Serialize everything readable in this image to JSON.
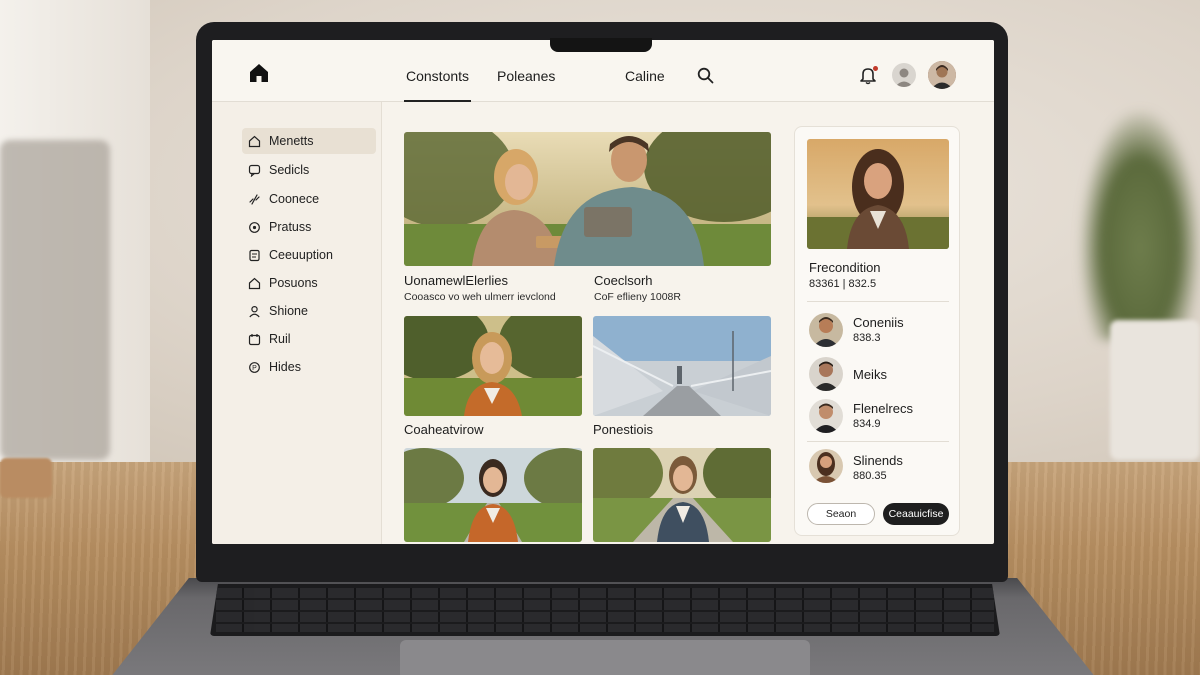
{
  "header": {
    "tabs": [
      {
        "label": "Constonts",
        "active": true
      },
      {
        "label": "Poleanes",
        "active": false
      },
      {
        "label": "Caline",
        "active": false
      }
    ],
    "icons": [
      "home-icon",
      "search-icon",
      "bell-icon",
      "avatar",
      "avatar"
    ]
  },
  "sidebar": {
    "items": [
      {
        "label": "Menetts",
        "icon": "home-icon",
        "active": true
      },
      {
        "label": "Sedicls",
        "icon": "chat-icon",
        "active": false
      },
      {
        "label": "Coonece",
        "icon": "link-icon",
        "active": false
      },
      {
        "label": "Pratuss",
        "icon": "settings-icon",
        "active": false
      },
      {
        "label": "Ceeuuption",
        "icon": "document-icon",
        "active": false
      },
      {
        "label": "Posuons",
        "icon": "home-icon",
        "active": false
      },
      {
        "label": "Shione",
        "icon": "user-icon",
        "active": false
      },
      {
        "label": "Ruil",
        "icon": "calendar-icon",
        "active": false
      },
      {
        "label": "Hides",
        "icon": "help-icon",
        "active": false
      }
    ]
  },
  "main": {
    "featured": {
      "title_left": "UonamewlElerlies",
      "subtitle_left": "Cooasco vo weh ulmerr ievclond",
      "title_right": "Coeclsorh",
      "subtitle_right": "CoF eflieny 1008R"
    },
    "cards": [
      {
        "caption": "Coaheatvirow"
      },
      {
        "caption": "Ponestiois"
      },
      {
        "caption": ""
      },
      {
        "caption": ""
      }
    ]
  },
  "panel": {
    "profile": {
      "name": "Frecondition",
      "stats": "83361 | 832.5"
    },
    "people": [
      {
        "name": "Coneniis",
        "value": "838.3"
      },
      {
        "name": "Meiks",
        "value": ""
      },
      {
        "name": "Flenelrecs",
        "value": "834.9"
      },
      {
        "name": "Slinends",
        "value": "880.35"
      }
    ],
    "buttons": {
      "secondary": "Seaon",
      "primary": "Ceaauicfise"
    }
  },
  "colors": {
    "accent": "#1e1e1e",
    "active_bg": "#e8e0d3",
    "surface": "#f7f3ec"
  }
}
